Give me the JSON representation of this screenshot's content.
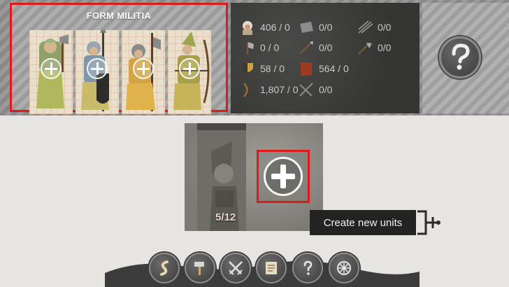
{
  "militia": {
    "title": "FORM MILITIA",
    "units": [
      {
        "icon": "axeman-unit-icon"
      },
      {
        "icon": "spearman-unit-icon"
      },
      {
        "icon": "halberdier-unit-icon"
      },
      {
        "icon": "archer-unit-icon"
      }
    ]
  },
  "resources": [
    {
      "icon": "peasant-icon",
      "value": "406 / 0"
    },
    {
      "icon": "stone-icon",
      "value": "0/0"
    },
    {
      "icon": "bows-icon",
      "value": "0/0"
    },
    {
      "icon": "axe-icon",
      "value": "0 / 0"
    },
    {
      "icon": "spear-icon",
      "value": "0/0"
    },
    {
      "icon": "halberd-icon",
      "value": "0/0"
    },
    {
      "icon": "shield-icon",
      "value": "58 / 0"
    },
    {
      "icon": "tower-shield-icon",
      "value": "564 / 0"
    },
    {
      "icon": "arrows-icon",
      "value": "1,807 / 0"
    },
    {
      "icon": "crossbow-icon",
      "value": "0/0"
    }
  ],
  "help_button": {
    "icon": "help-icon"
  },
  "create_card": {
    "count": "5/12",
    "add_icon": "plus-icon"
  },
  "tooltip": {
    "text": "Create new units"
  },
  "bottom_bar": [
    {
      "icon": "road-icon"
    },
    {
      "icon": "hammer-icon"
    },
    {
      "icon": "crossed-swords-icon"
    },
    {
      "icon": "scroll-map-icon"
    },
    {
      "icon": "help-icon"
    },
    {
      "icon": "settings-wheel-icon"
    }
  ],
  "colors": {
    "highlight": "#e01a1a",
    "count_text": "#e8d2cf",
    "tooltip_bg": "#232323"
  }
}
